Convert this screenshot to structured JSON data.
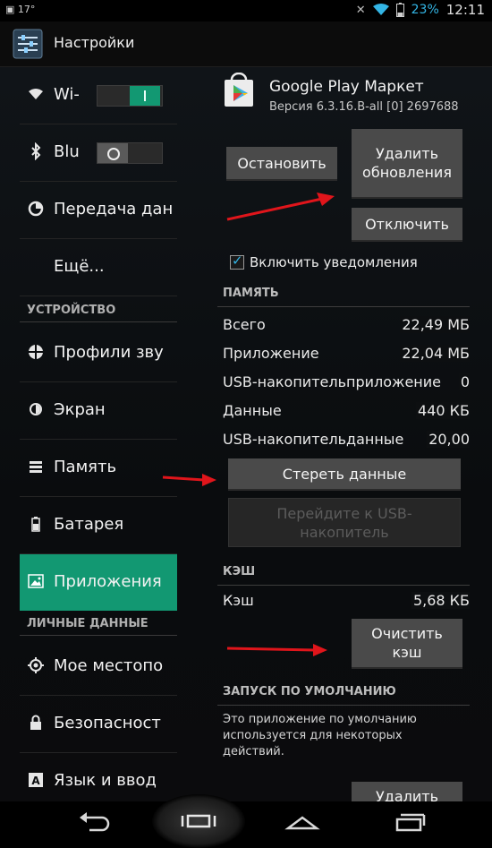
{
  "status_bar": {
    "battery_percent": "23%",
    "time": "12:11",
    "left_indicator": "17°"
  },
  "action_bar": {
    "title": "Настройки"
  },
  "sidebar": {
    "items": [
      {
        "label": "Wi-",
        "toggle_on": true
      },
      {
        "label": "Blu",
        "toggle_on": false
      },
      {
        "label": "Передача дан"
      },
      {
        "label": "Ещё..."
      },
      {
        "label": "Профили зву"
      },
      {
        "label": "Экран"
      },
      {
        "label": "Память"
      },
      {
        "label": "Батарея"
      },
      {
        "label": "Приложения",
        "active": true
      },
      {
        "label": "Мое местопо"
      },
      {
        "label": "Безопасност"
      },
      {
        "label": "Язык и ввод"
      }
    ],
    "headers": {
      "device": "УСТРОЙСТВО",
      "personal": "ЛИЧНЫЕ ДАННЫЕ"
    }
  },
  "app": {
    "name": "Google Play Маркет",
    "version": "Версия 6.3.16.B-all [0] 2697688"
  },
  "buttons": {
    "stop": "Остановить",
    "uninstall_updates": "Удалить обновления",
    "disable": "Отключить",
    "clear_data": "Стереть данные",
    "move_to_usb": "Перейдите к USB-накопитель",
    "clear_cache": "Очистить кэш",
    "clear_defaults": "Удалить"
  },
  "notifications": {
    "label": "Включить уведомления",
    "checked": true
  },
  "storage": {
    "header": "ПАМЯТЬ",
    "rows": [
      {
        "label": "Всего",
        "value": "22,49 МБ"
      },
      {
        "label": "Приложение",
        "value": "22,04 МБ"
      },
      {
        "label": "USB-накопительприложение",
        "value": "0"
      },
      {
        "label": "Данные",
        "value": "440 КБ"
      },
      {
        "label": "USB-накопительданные",
        "value": "20,00"
      }
    ]
  },
  "cache": {
    "header": "КЭШ",
    "label": "Кэш",
    "value": "5,68 КБ"
  },
  "launch_default": {
    "header": "ЗАПУСК ПО УМОЛЧАНИЮ",
    "description": "Это приложение по умолчанию используется для некоторых действий."
  },
  "colors": {
    "accent": "#129872",
    "holo_blue": "#33b5e5",
    "annotation_arrow": "#e0151b"
  }
}
